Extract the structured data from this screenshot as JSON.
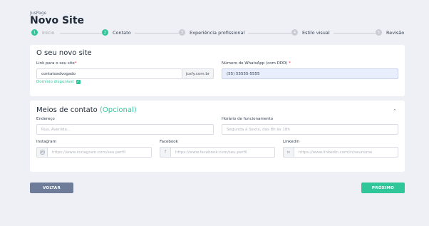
{
  "header": {
    "brand": "JusPage",
    "title": "Novo Site"
  },
  "steps": [
    {
      "num": "1",
      "label": "Início",
      "done": true
    },
    {
      "num": "2",
      "label": "Contato",
      "done": true
    },
    {
      "num": "3",
      "label": "Experiência profissional",
      "done": false
    },
    {
      "num": "4",
      "label": "Estilo visual",
      "done": false
    },
    {
      "num": "5",
      "label": "Revisão",
      "done": false
    }
  ],
  "site_section": {
    "title": "O seu novo site",
    "link_label": "Link para o seu site",
    "required_mark": "*",
    "link_value": "contatoadvogado",
    "link_suffix": "jusfy.com.br",
    "domain_status": "Domínio disponível",
    "whatsapp_label": "Número do WhatsApp (com DDD)",
    "whatsapp_value": "(55) 55555-5555"
  },
  "contact_section": {
    "title": "Meios de contato",
    "optional": "(Opcional)",
    "address_label": "Endereço",
    "address_placeholder": "Rua, Avenida...",
    "hours_label": "Horário de funcionamento",
    "hours_placeholder": "Segunda à Sexta, das 8h às 18h",
    "instagram_label": "Instagram",
    "instagram_placeholder": "https://www.instagram.com/seu.perfil",
    "facebook_label": "Facebook",
    "facebook_placeholder": "https://www.facebook.com/seu.perfil",
    "linkedin_label": "Linkedin",
    "linkedin_placeholder": "https://www.linkedin.com/in/seunome"
  },
  "footer": {
    "back_label": "VOLTAR",
    "next_label": "PRÓXIMO"
  },
  "icons": {
    "instagram": "instagram-icon",
    "facebook": "facebook-icon",
    "linkedin": "linkedin-icon",
    "check": "check-icon",
    "chevron": "chevron-up-icon"
  },
  "colors": {
    "accent": "#2fc79a",
    "back_button": "#6f7c99",
    "required": "#e11d48"
  }
}
